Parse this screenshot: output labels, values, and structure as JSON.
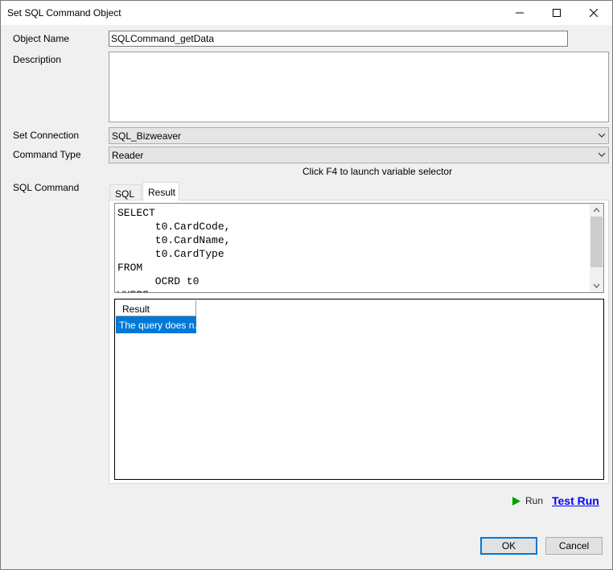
{
  "window": {
    "title": "Set SQL Command Object",
    "minimize_icon": "minimize-icon",
    "maximize_icon": "maximize-icon",
    "close_icon": "close-icon"
  },
  "form": {
    "object_name_label": "Object Name",
    "object_name_value": "SQLCommand_getData",
    "description_label": "Description",
    "description_value": "",
    "set_connection_label": "Set Connection",
    "set_connection_value": "SQL_Bizweaver",
    "command_type_label": "Command Type",
    "command_type_value": "Reader",
    "hint": "Click F4 to launch variable selector",
    "sql_command_label": "SQL Command"
  },
  "tabs": [
    {
      "label": "SQL",
      "active": false
    },
    {
      "label": "Result",
      "active": true
    }
  ],
  "editor": {
    "code": "SELECT\n      t0.CardCode,\n      t0.CardName,\n      t0.CardType\nFROM\n      OCRD t0\nWHERE"
  },
  "result_grid": {
    "columns": [
      "Result"
    ],
    "rows": [
      [
        "The query does n..."
      ]
    ],
    "selected_color": "#0078d7"
  },
  "actions": {
    "run_label": "Run",
    "run_icon": "play-icon",
    "run_icon_color": "#00a000",
    "test_run_label": "Test Run",
    "ok_label": "OK",
    "cancel_label": "Cancel"
  }
}
